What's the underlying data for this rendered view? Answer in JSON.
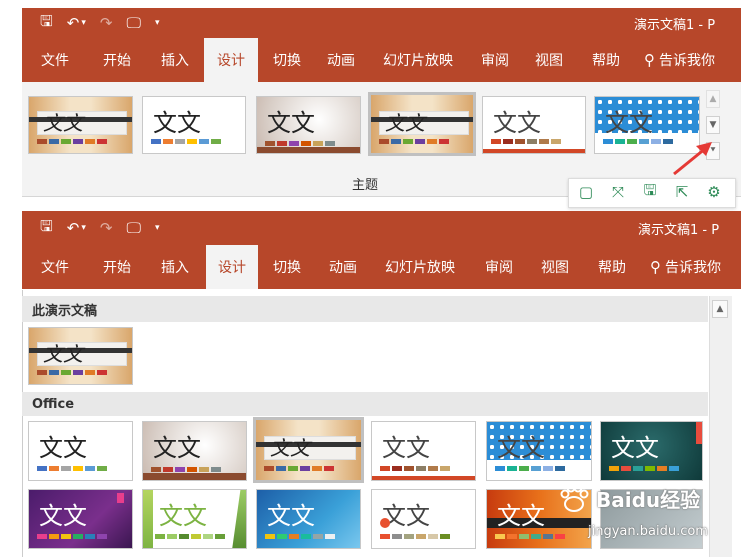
{
  "top": {
    "title": "演示文稿1  -  P",
    "qat_icons": [
      "save-icon",
      "undo-icon",
      "redo-icon",
      "present-icon"
    ],
    "qat_glyphs": {
      "save": "🖫",
      "undo": "↶",
      "undo_arrow": "▾",
      "redo": "↷",
      "present": "🖵",
      "customize": "▾"
    },
    "tabs": [
      "文件",
      "开始",
      "插入",
      "设计",
      "切换",
      "动画",
      "幻灯片放映",
      "审阅",
      "视图",
      "帮助"
    ],
    "active_tab": "设计",
    "tell_me": "告诉我你",
    "group_label": "主题",
    "scroll": {
      "up": "▲",
      "down": "▼",
      "more": "⯆"
    },
    "mini_toolbar": {
      "glyphs": [
        "▢",
        "⤧",
        "🖫",
        "⇱",
        "⚙"
      ],
      "icons": [
        "fit-icon",
        "expand-icon",
        "save-icon",
        "share-icon",
        "settings-icon"
      ]
    }
  },
  "bottom": {
    "title": "演示文稿1  -  P",
    "section_current": "此演示文稿",
    "section_office": "Office"
  },
  "theme_text": "文文",
  "theme_text_brush": "文文",
  "watermark": {
    "logo": "Baidu经验",
    "url": "jingyan.baidu.com"
  },
  "colors": {
    "accent": "#b7472a",
    "ribbon": "#f3f3f3",
    "arrow": "#e53935"
  }
}
